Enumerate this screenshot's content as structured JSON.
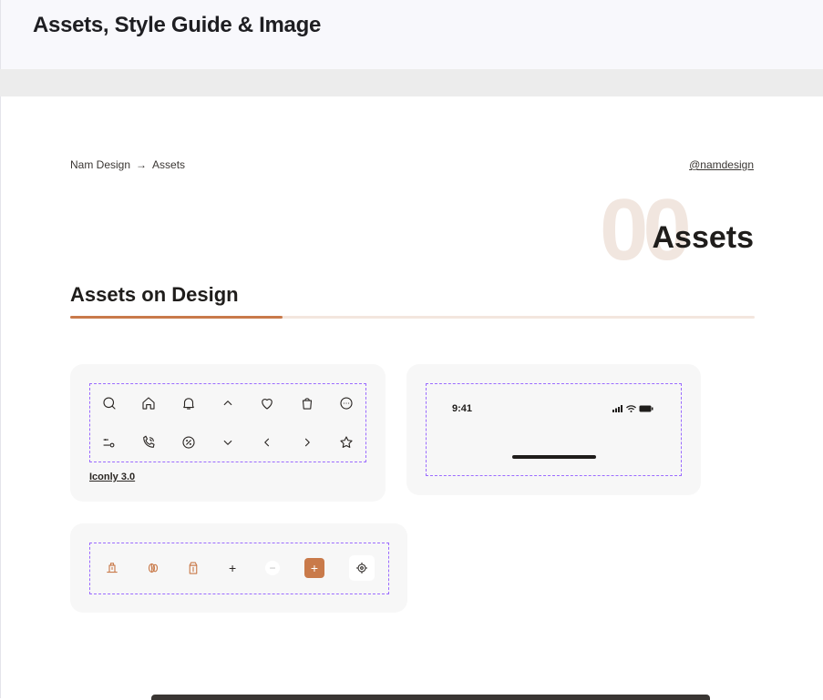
{
  "header": {
    "title": "Assets, Style Guide & Image"
  },
  "breadcrumb": {
    "root": "Nam Design",
    "separator": "→",
    "current": "Assets"
  },
  "handle": "@namdesign",
  "hero": {
    "number": "00",
    "title": "Assets"
  },
  "section": {
    "title": "Assets on Design",
    "progress_fraction": 0.31
  },
  "icon_card": {
    "caption": "Iconly 3.0",
    "row1": [
      "search-icon",
      "home-icon",
      "bell-icon",
      "chevron-up-icon",
      "heart-icon",
      "bag-icon",
      "more-circle-icon"
    ],
    "row2": [
      "filter-icon",
      "call-icon",
      "discount-icon",
      "chevron-down-icon",
      "chevron-left-icon",
      "chevron-right-icon",
      "star-icon"
    ]
  },
  "status_card": {
    "time": "9:41",
    "icons": [
      "signal-icon",
      "wifi-icon",
      "battery-icon"
    ]
  },
  "assets_row": {
    "icons": [
      "coffee-machine-icon",
      "coffee-bean-icon",
      "coffee-bag-icon",
      "plus-icon",
      "minus-icon",
      "add-button-icon",
      "location-target-icon"
    ],
    "plus": "+",
    "minus": "−",
    "add_button": "+"
  },
  "colors": {
    "accent": "#c97a4a",
    "dashed": "#9b6bff",
    "card": "#f7f7f7"
  }
}
